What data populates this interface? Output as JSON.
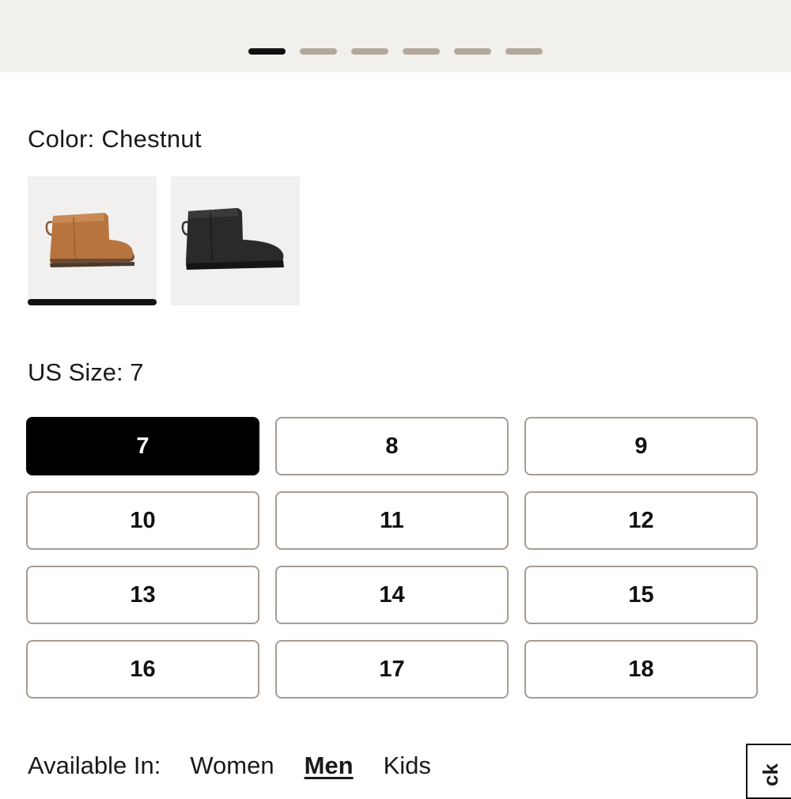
{
  "carousel": {
    "slide_count": 6,
    "active_index": 0
  },
  "color": {
    "label": "Color: Chestnut",
    "swatches": [
      {
        "name": "Chestnut",
        "color": "#b0703f",
        "selected": true
      },
      {
        "name": "Black",
        "color": "#222222",
        "selected": false
      }
    ]
  },
  "size": {
    "label": "US Size: 7",
    "options": [
      "7",
      "8",
      "9",
      "10",
      "11",
      "12",
      "13",
      "14",
      "15",
      "16",
      "17",
      "18"
    ],
    "selected": "7"
  },
  "available": {
    "label": "Available In:",
    "options": [
      "Women",
      "Men",
      "Kids"
    ],
    "active": "Men"
  },
  "side_tab": {
    "label": "ck"
  }
}
